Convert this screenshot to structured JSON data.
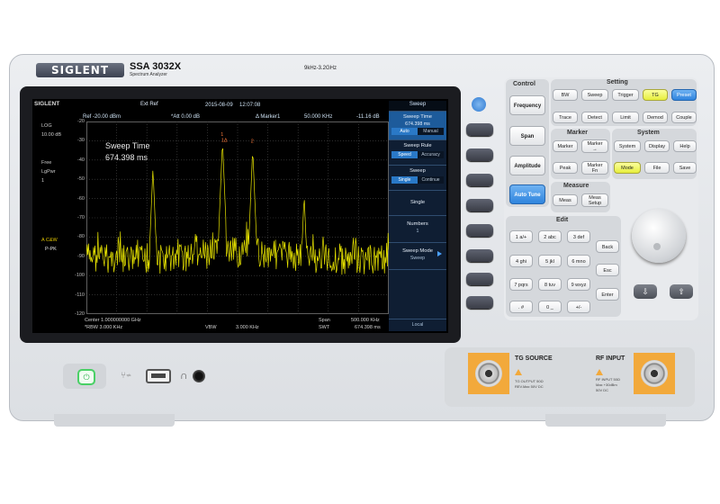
{
  "device": {
    "brand": "SIGLENT",
    "model": "SSA 3032X",
    "subtitle": "Spectrum Analyzer",
    "freq_range": "9kHz-3.2GHz"
  },
  "screen": {
    "brand": "SIGLENT",
    "status": {
      "ext_ref": "Ext Ref",
      "date": "2015-08-09",
      "time": "12:07:08"
    },
    "header": {
      "ref": "Ref  -20.00 dBm",
      "att": "*Att  0.00 dB",
      "marker": "Δ Marker1",
      "marker_freq": "50.000  KHz",
      "marker_val": "-11.16 dB"
    },
    "left_info": [
      "LOG",
      "10.00 dB",
      "Free",
      "LgPwr",
      "1"
    ],
    "trace_info": [
      "A C&W",
      "P-PK"
    ],
    "overlay": {
      "label": "Sweep Time",
      "value": "674.398 ms"
    },
    "y_ticks": [
      "-20",
      "-30",
      "-40",
      "-50",
      "-60",
      "-70",
      "-80",
      "-90",
      "-100",
      "-110",
      "-120"
    ],
    "bottom": {
      "center": "Center  1.000000000  GHz",
      "span": "Span",
      "span_val": "500.000  KHz",
      "rbw": "*RBW          3.000  KHz",
      "vbw": "VBW",
      "vbw_val": "3.000  KHz",
      "swt": "SWT",
      "swt_val": "674.398  ms"
    },
    "markers": [
      "1",
      "1Δ",
      "2"
    ],
    "trace_color": "#e8e400",
    "menu": {
      "title": "Sweep",
      "sweep_time": {
        "label": "Sweep Time",
        "value": "674.398 ms",
        "opt1": "Auto",
        "opt2": "Manual"
      },
      "sweep_rule": {
        "label": "Sweep Rule",
        "opt1": "Speed",
        "opt2": "Accuracy"
      },
      "sweep": {
        "label": "Sweep",
        "opt1": "Single",
        "opt2": "Continue"
      },
      "single": "Single",
      "numbers": {
        "label": "Numbers",
        "value": "1"
      },
      "sweep_mode": {
        "label": "Sweep Mode",
        "value": "Sweep"
      },
      "local": "Local"
    }
  },
  "panel": {
    "control": {
      "title": "Control",
      "frequency": "Frequency",
      "span": "Span",
      "amplitude": "Amplitude",
      "auto_tune": "Auto Tune"
    },
    "setting": {
      "title": "Setting",
      "bw": "BW",
      "sweep": "Sweep",
      "trigger": "Trigger",
      "tg": "TG",
      "preset": "Preset",
      "trace": "Trace",
      "detect": "Detect",
      "limit": "Limit",
      "demod": "Demod",
      "couple": "Couple"
    },
    "marker": {
      "title": "Marker",
      "marker": "Marker",
      "marker_to": "Marker",
      "marker_to2": "→",
      "peak": "Peak",
      "marker_fn": "Marker",
      "marker_fn2": "Fn"
    },
    "system": {
      "title": "System",
      "system": "System",
      "display": "Display",
      "help": "Help",
      "mode": "Mode",
      "file": "File",
      "save": "Save"
    },
    "measure": {
      "title": "Measure",
      "meas": "Meas",
      "meas_setup": "Meas",
      "meas_setup2": "Setup"
    },
    "edit": {
      "title": "Edit",
      "keys": [
        "7 pqrs",
        "8 tuv",
        "9 wxyz",
        "4 ghi",
        "5 jkl",
        "6 mno",
        "1 a/+",
        "2 abc",
        "3 def",
        ". #",
        "0 _",
        "+/-"
      ],
      "back": "Back",
      "esc": "Esc",
      "enter": "Enter"
    },
    "arrows": {
      "down": "⇩",
      "up": "⇧"
    }
  },
  "front": {
    "power": "⏻",
    "usb": "⑂⇌",
    "phones": "∩",
    "tg_source": {
      "title": "TG SOURCE",
      "warn": [
        "TG OUTPUT 50Ω",
        "REV.Max 50V DC"
      ]
    },
    "rf_input": {
      "title": "RF INPUT",
      "warn": [
        "RF INPUT 50Ω",
        "Max +30dBm",
        "50V DC"
      ]
    }
  }
}
